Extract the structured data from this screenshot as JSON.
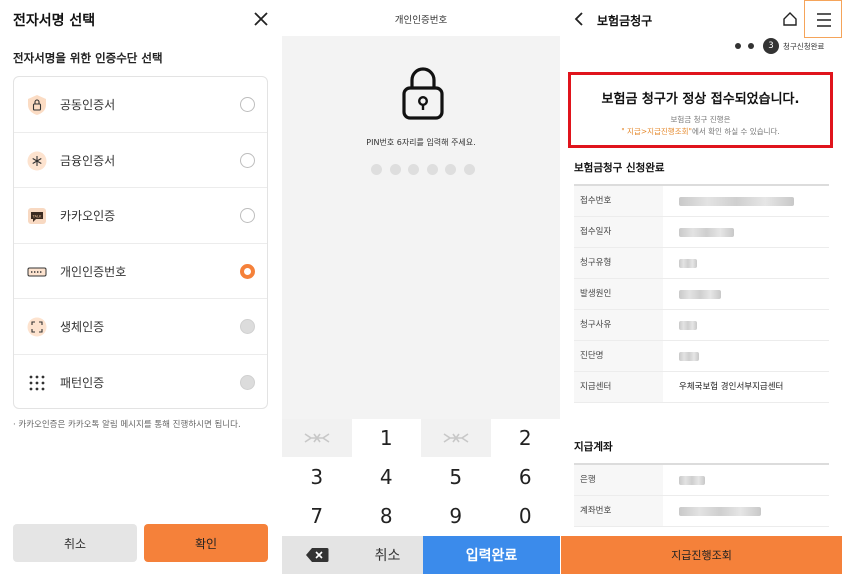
{
  "panel1": {
    "title": "전자서명 선택",
    "subtitle": "전자서명을 위한 인증수단 선택",
    "methods": [
      {
        "label": "공동인증서",
        "icon": "lock-certificate-icon",
        "state": "unselected"
      },
      {
        "label": "금융인증서",
        "icon": "asterisk-certificate-icon",
        "state": "unselected"
      },
      {
        "label": "카카오인증",
        "icon": "kakao-talk-icon",
        "state": "unselected"
      },
      {
        "label": "개인인증번호",
        "icon": "pin-keyboard-icon",
        "state": "selected"
      },
      {
        "label": "생체인증",
        "icon": "biometric-scan-icon",
        "state": "disabled"
      },
      {
        "label": "패턴인증",
        "icon": "pattern-grid-icon",
        "state": "disabled"
      }
    ],
    "note": "카카오인증은 카카오톡 알림 메시지를 통해 진행하시면 됩니다.",
    "cancel_label": "취소",
    "confirm_label": "확인",
    "accent_color": "#f5813a"
  },
  "panel2": {
    "title": "개인인증번호",
    "message": "PIN번호 6자리를 입력해 주세요.",
    "pin_length": 6,
    "keys": [
      "shuffle",
      "1",
      "shuffle",
      "2",
      "3",
      "4",
      "5",
      "6",
      "7",
      "8",
      "9",
      "0"
    ],
    "cancel_label": "취소",
    "done_label": "입력완료",
    "done_color": "#3b8beb"
  },
  "panel3": {
    "title": "보험금청구",
    "step_number": "3",
    "step_label": "청구신청완료",
    "notice_heading": "보험금 청구가 정상 접수되었습니다.",
    "notice_line1": "보험금 청구 진행은",
    "notice_link": "\" 지급>지급진행조회\"",
    "notice_line2_suffix": "에서 확인 하실 수 있습니다.",
    "section1_title": "보험금청구 신청완료",
    "section1_rows": [
      {
        "label": "접수번호",
        "value": ""
      },
      {
        "label": "접수일자",
        "value": ""
      },
      {
        "label": "청구유형",
        "value": ""
      },
      {
        "label": "발생원인",
        "value": ""
      },
      {
        "label": "청구사유",
        "value": ""
      },
      {
        "label": "진단명",
        "value": ""
      },
      {
        "label": "지급센터",
        "value": "우체국보험 경인서부지급센터"
      }
    ],
    "section2_title": "지급계좌",
    "section2_rows": [
      {
        "label": "은행",
        "value": ""
      },
      {
        "label": "계좌번호",
        "value": ""
      }
    ],
    "bottom_button": "지급진행조회",
    "highlight_color": "#e0141c"
  }
}
